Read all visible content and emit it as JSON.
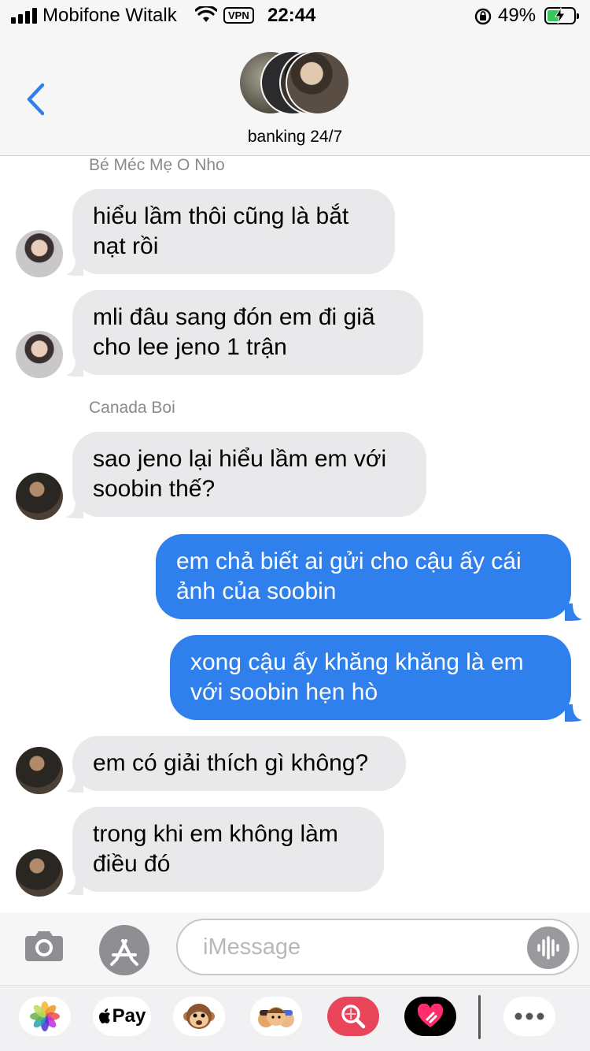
{
  "status_bar": {
    "carrier": "Mobifone Witalk",
    "vpn": "VPN",
    "time": "22:44",
    "battery_percent": "49%",
    "battery_level": 0.49
  },
  "header": {
    "group_name": "banking 24/7"
  },
  "messages": [
    {
      "sender": "Bé Méc Mẹ O Nho"
    },
    {
      "text": "hiểu lầm thôi cũng là bắt nạt rồi"
    },
    {
      "text": "mli đâu sang đón em đi giã cho lee jeno 1 trận"
    },
    {
      "sender": "Canada Boi"
    },
    {
      "text": "sao jeno lại hiểu lầm em với soobin thế?"
    },
    {
      "text": "em chả biết ai gửi cho cậu ấy cái ảnh của soobin"
    },
    {
      "text": "xong cậu ấy khăng khăng là em với soobin hẹn hò"
    },
    {
      "text": "em có giải thích gì không?"
    },
    {
      "text": "trong khi em không làm điều đó"
    }
  ],
  "composer": {
    "placeholder": "iMessage"
  },
  "drawer": {
    "apple_pay_label": "Pay"
  },
  "colors": {
    "outgoing_bubble": "#2f80ed",
    "incoming_bubble": "#e9e9eb",
    "accent": "#2f80ed"
  }
}
